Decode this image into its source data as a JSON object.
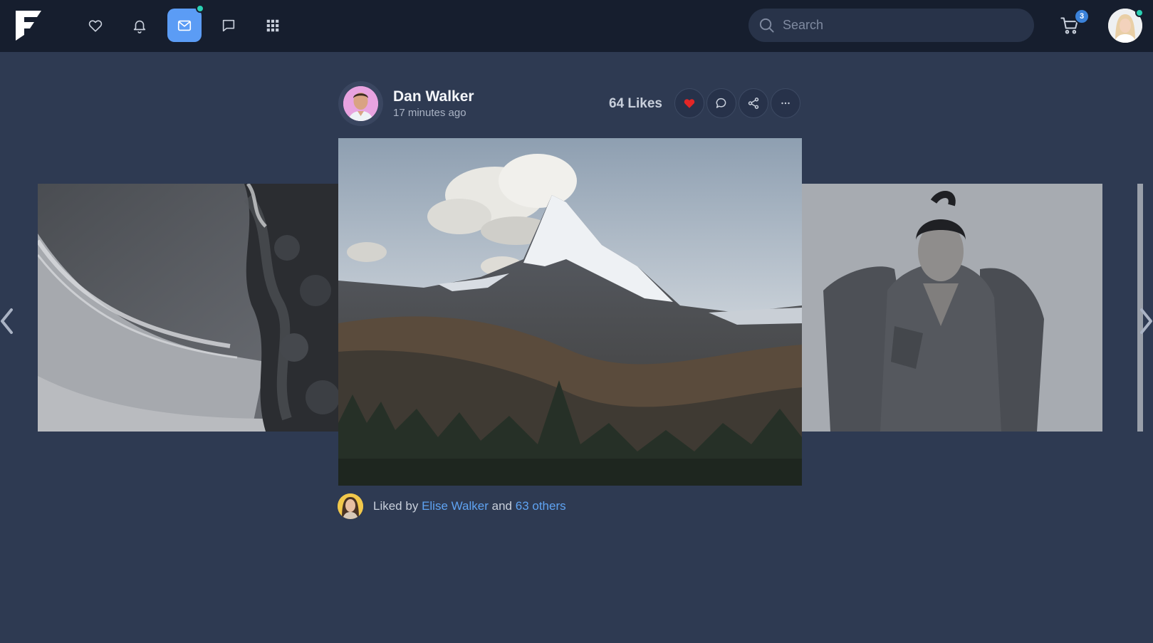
{
  "navbar": {
    "logo": "F",
    "icons": [
      "heart-icon",
      "bell-icon",
      "mail-icon",
      "chat-icon",
      "apps-grid-icon"
    ],
    "active": "mail-icon",
    "search_placeholder": "Search",
    "cart_count": "3"
  },
  "post": {
    "author": "Dan Walker",
    "time": "17 minutes ago",
    "likes": "64 Likes",
    "liked_by_prefix": "Liked by",
    "liked_by_user": "Elise Walker",
    "liked_by_and": "and",
    "liked_by_others": "63 others"
  },
  "colors": {
    "background": "#2e3a52",
    "navbar": "#161e2e",
    "accent": "#5b9cf5",
    "online_dot": "#2ad1b4",
    "link": "#5fa3f2",
    "like_heart": "#e32626"
  }
}
